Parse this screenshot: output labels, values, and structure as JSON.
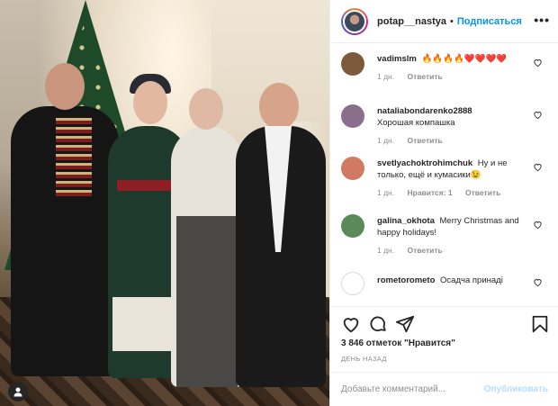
{
  "header": {
    "username": "potap__nastya",
    "separator": "•",
    "follow_label": "Подписаться",
    "more_icon": "more-horizontal-icon"
  },
  "comments": [
    {
      "user": "vadimslm",
      "text": "🔥🔥🔥🔥❤️❤️❤️❤️",
      "time": "1 дн.",
      "likes": "",
      "reply": "Ответить",
      "avatar_color": "#7a5a3a"
    },
    {
      "user": "nataliabondarenko2888",
      "text": "Хорошая компашка",
      "time": "1 дн.",
      "likes": "",
      "reply": "Ответить",
      "avatar_color": "#8a6f8a"
    },
    {
      "user": "svetlyachoktrohimchuk",
      "text": "Ну и не только, ещё и кумасики😉",
      "time": "1 дн.",
      "likes": "Нравится: 1",
      "reply": "Ответить",
      "avatar_color": "#d07a64"
    },
    {
      "user": "galina_okhota",
      "text": "Merry Christmas and happy holidays!",
      "time": "1 дн.",
      "likes": "",
      "reply": "Ответить",
      "avatar_color": "#5a8a5a"
    },
    {
      "user": "rometorometo",
      "text": "Осадча принаді",
      "time": "",
      "likes": "",
      "reply": "",
      "avatar_color": "#d9d9d9"
    }
  ],
  "post": {
    "likes_text": "3 846 отметок \"Нравится\"",
    "date_text": "ДЕНЬ НАЗАД"
  },
  "add_comment": {
    "placeholder": "Добавьте комментарий...",
    "publish_label": "Опубликовать"
  },
  "colors": {
    "accent": "#0095f6",
    "publish_disabled": "#b2dffc",
    "meta": "#8e8e8e"
  }
}
